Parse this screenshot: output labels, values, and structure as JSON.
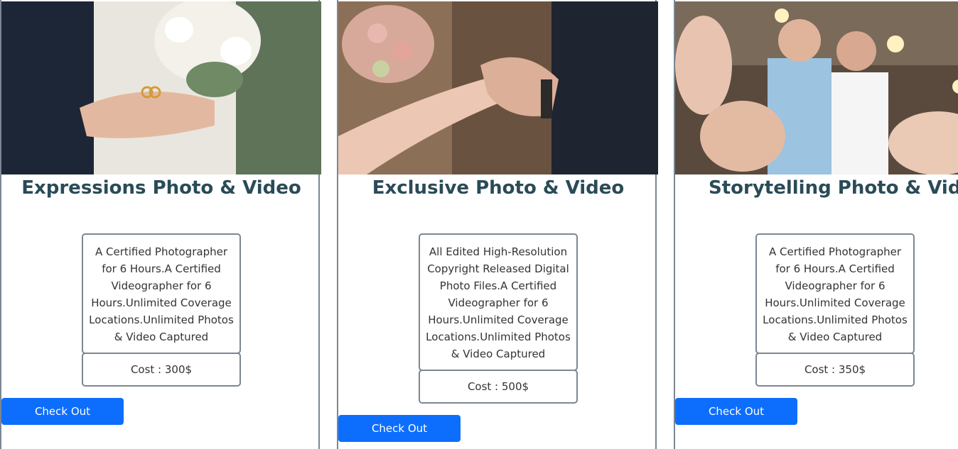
{
  "packages": [
    {
      "title": "Expressions Photo & Video",
      "description": "A Certified Photographer for 6 Hours.A Certified Videographer for 6 Hours.Unlimited Coverage Locations.Unlimited Photos & Video Captured",
      "cost": "Cost : 300$",
      "button_label": "Check Out",
      "image": "wedding-rings-in-hand-photo"
    },
    {
      "title": "Exclusive Photo & Video",
      "description": "All Edited High-Resolution Copyright Released Digital Photo Files.A Certified Videographer for 6 Hours.Unlimited Coverage Locations.Unlimited Photos & Video Captured",
      "cost": "Cost : 500$",
      "button_label": "Check Out",
      "image": "couple-holding-hands-photo"
    },
    {
      "title": "Storytelling Photo & Video",
      "description": "A Certified Photographer for 6 Hours.A Certified Videographer for 6 Hours.Unlimited Coverage Locations.Unlimited Photos & Video Captured",
      "cost": "Cost : 350$",
      "button_label": "Check Out",
      "image": "couple-with-sparklers-photo"
    }
  ],
  "colors": {
    "title": "#2a4b57",
    "button": "#0d6efd",
    "border": "#7b8794"
  }
}
